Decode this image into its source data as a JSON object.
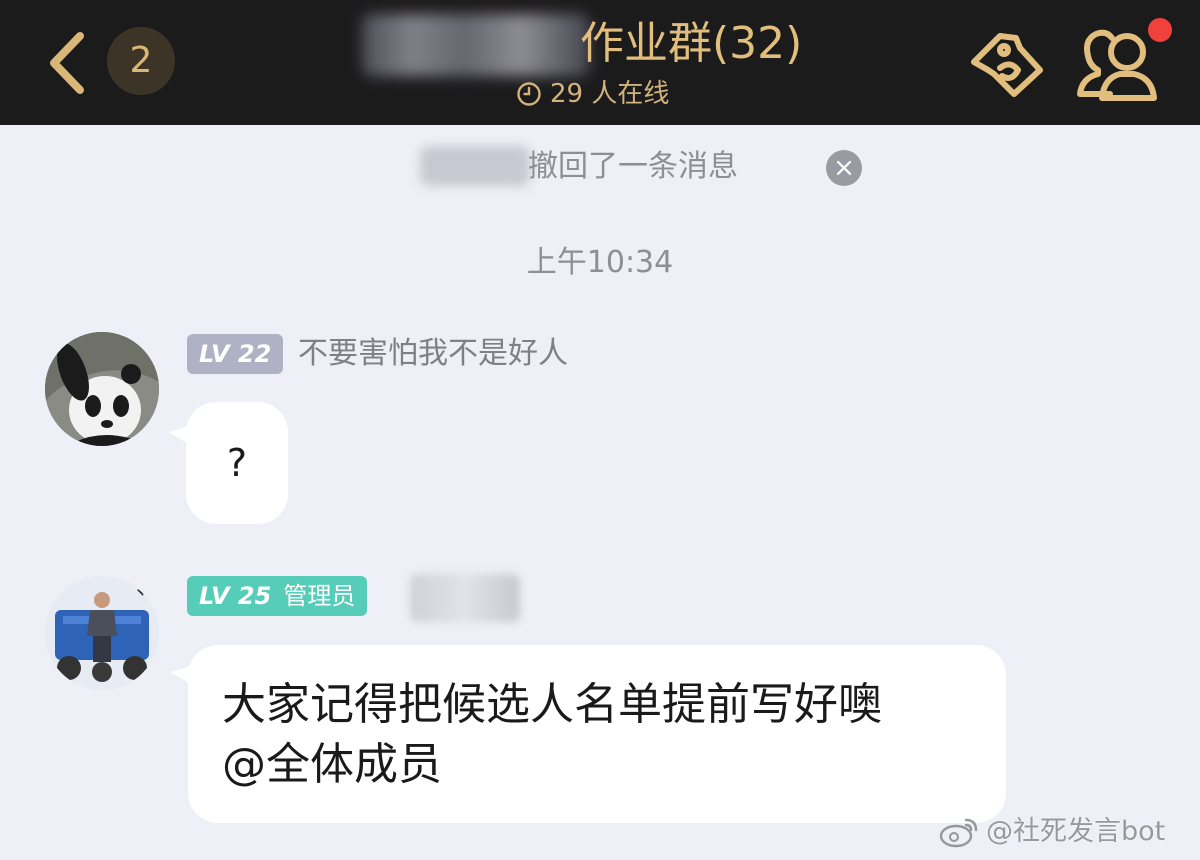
{
  "header": {
    "unread_count": "2",
    "title": "作业群(32)",
    "online_text": "29 人在线"
  },
  "recall_notice": {
    "text": "撤回了一条消息",
    "close_glyph": "×"
  },
  "timestamp": "上午10:34",
  "messages": [
    {
      "level": "LV 22",
      "sender": "不要害怕我不是好人",
      "text": "?"
    },
    {
      "level": "LV 25",
      "role": "管理员",
      "lines": [
        "大家记得把候选人名单提前写好噢",
        "@全体成员"
      ]
    }
  ],
  "watermark": "@社死发言bot",
  "colors": {
    "header_bg": "#1c1b1c",
    "header_gold": "#e1be7d",
    "chat_bg": "#eeeff7",
    "admin_badge": "#56cdb9",
    "level_badge": "#aeb2c4",
    "notification_dot": "#f0413d"
  },
  "icons": [
    "chevron-left-icon",
    "clock-icon",
    "ticket-tag-icon",
    "group-members-icon",
    "close-icon",
    "weibo-icon"
  ]
}
